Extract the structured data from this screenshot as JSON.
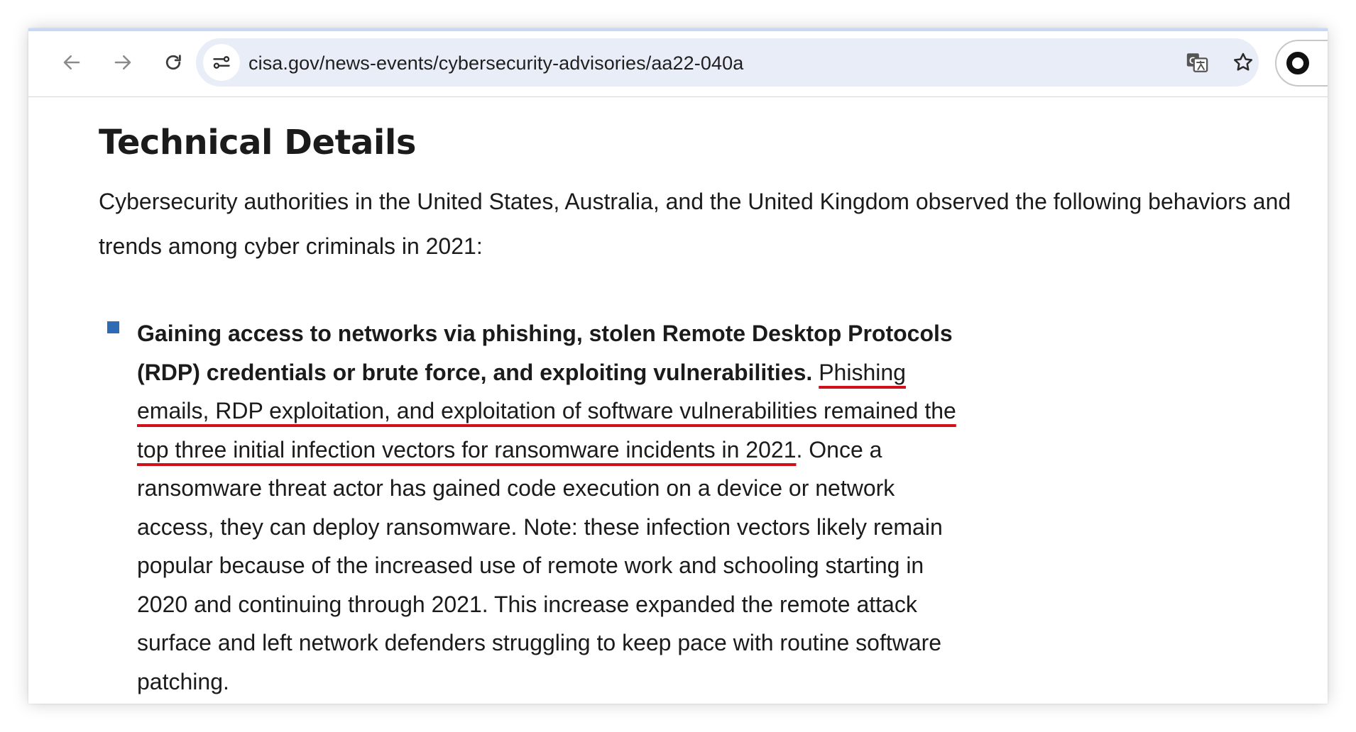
{
  "browser": {
    "url": "cisa.gov/news-events/cybersecurity-advisories/aa22-040a",
    "icons": {
      "back": "back-arrow-icon",
      "forward": "forward-arrow-icon",
      "reload": "reload-icon",
      "site_info": "site-settings-icon",
      "translate": "translate-icon",
      "bookmark": "star-icon",
      "profile": "profile-icon"
    },
    "accent_color": "#c8d8f4",
    "omnibox_color": "#e9edf8"
  },
  "article": {
    "section_title": "Technical Details",
    "intro": "Cybersecurity authorities in the United States, Australia, and the United Kingdom observed the following behaviors and trends among cyber criminals in 2021:",
    "bullets": [
      {
        "bold_lead": "Gaining access to networks via phishing, stolen Remote Desktop Protocols (RDP) credentials or brute force, and exploiting vulnerabilities.",
        "highlighted": "Phishing emails, RDP exploitation, and exploitation of software vulnerabilities remained the top three initial infection vectors for ransomware incidents in 2021",
        "rest": ". Once a ransomware threat actor has gained code execution on a device or network access, they can deploy ransomware. Note: these infection vectors likely remain popular because of the increased use of remote work and schooling starting in 2020 and continuing through 2021. This increase expanded the remote attack surface and left network defenders struggling to keep pace with routine software patching."
      }
    ],
    "bullet_color": "#2e6bb5",
    "highlight_color": "#d0111b"
  }
}
